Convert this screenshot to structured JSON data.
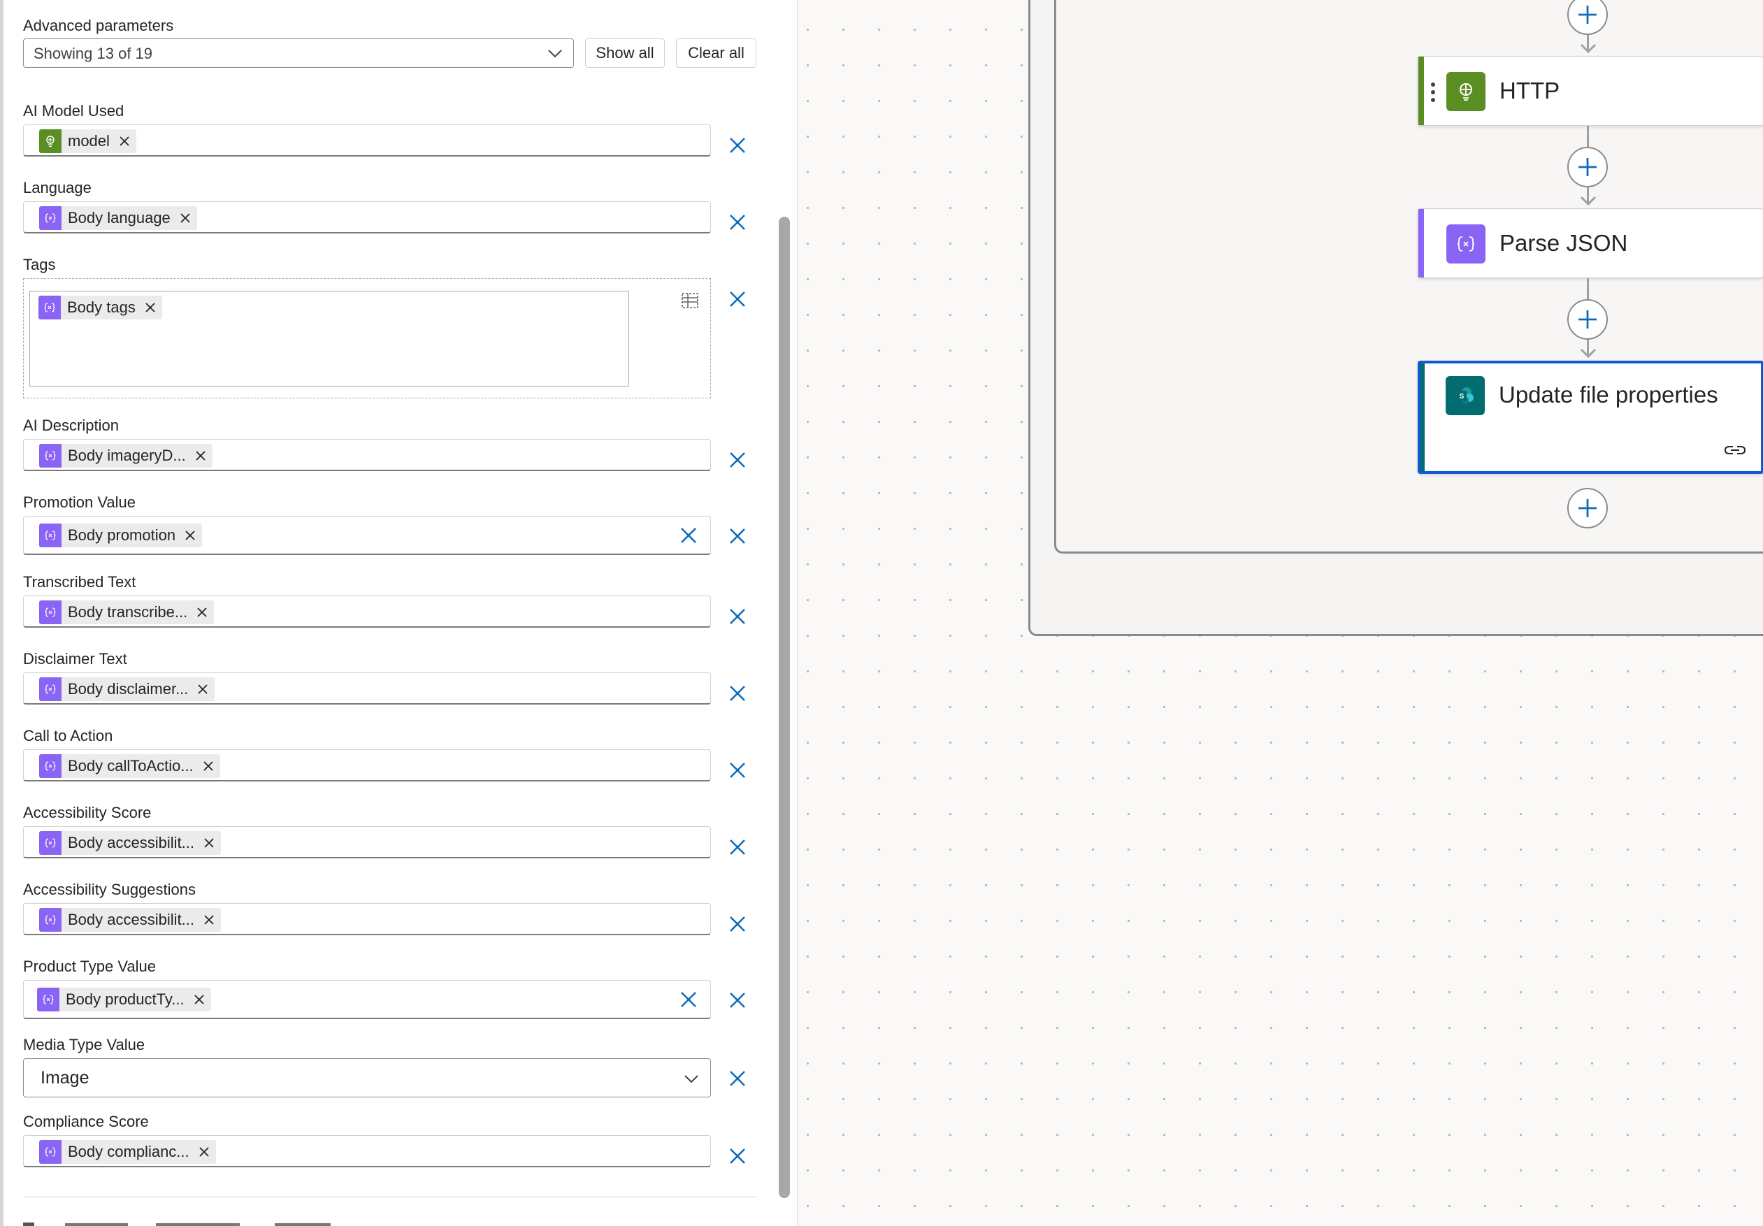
{
  "panel": {
    "advanced_parameters_label": "Advanced parameters",
    "advanced_parameters_value": "Showing 13 of 19",
    "show_all_label": "Show all",
    "clear_all_label": "Clear all"
  },
  "params": {
    "ai_model": {
      "label": "AI Model Used",
      "token": "model"
    },
    "language": {
      "label": "Language",
      "token": "Body language"
    },
    "tags": {
      "label": "Tags",
      "token": "Body tags"
    },
    "ai_description": {
      "label": "AI Description",
      "token": "Body imageryD..."
    },
    "promotion_value": {
      "label": "Promotion Value",
      "token": "Body promotion"
    },
    "transcribed_text": {
      "label": "Transcribed Text",
      "token": "Body transcribe..."
    },
    "disclaimer_text": {
      "label": "Disclaimer Text",
      "token": "Body disclaimer..."
    },
    "call_to_action": {
      "label": "Call to Action",
      "token": "Body callToActio..."
    },
    "accessibility_score": {
      "label": "Accessibility Score",
      "token": "Body accessibilit..."
    },
    "accessibility_suggestions": {
      "label": "Accessibility Suggestions",
      "token": "Body accessibilit..."
    },
    "product_type_value": {
      "label": "Product Type Value",
      "token": "Body productTy..."
    },
    "media_type_value": {
      "label": "Media Type Value",
      "value": "Image"
    },
    "compliance_score": {
      "label": "Compliance Score",
      "token": "Body complianc..."
    }
  },
  "flow": {
    "http_card": {
      "title": "HTTP",
      "icon": "globe-bulb-icon",
      "accent": "#5a8e22"
    },
    "parse_json_card": {
      "title": "Parse JSON",
      "icon": "curly-braces-icon",
      "accent": "#8a64f5"
    },
    "update_file_card": {
      "title": "Update file properties",
      "icon": "sharepoint-icon",
      "accent": "#036c70"
    }
  },
  "colors": {
    "accent_blue": "#0f6cbd",
    "token_purple": "#8a64f5",
    "token_green": "#5a8e22",
    "selected_border": "#0f5bd1"
  }
}
